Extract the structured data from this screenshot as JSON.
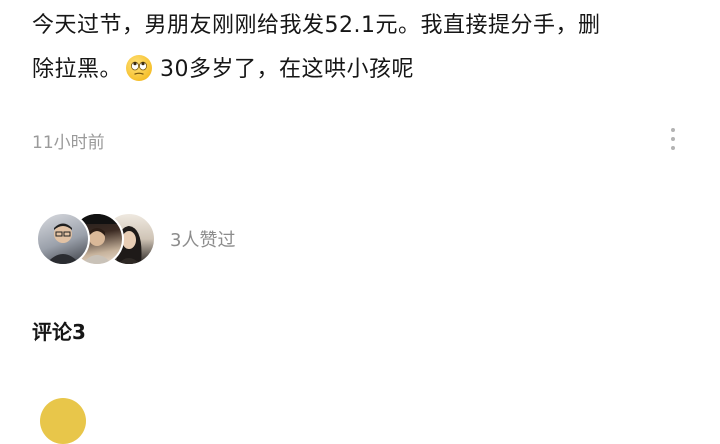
{
  "post": {
    "text_line1": "今天过节，男朋友刚刚给我发52.1元。我直接提分手，删",
    "text_line2_before": "除拉黑。",
    "emoji_icon": "eye-roll-emoji",
    "text_line2_after": "30多岁了，在这哄小孩呢"
  },
  "meta": {
    "timestamp": "11小时前",
    "more_icon": "vertical-ellipsis-icon"
  },
  "likes": {
    "text": "3人赞过",
    "avatar_count": 3
  },
  "comments": {
    "title": "评论3"
  },
  "colors": {
    "text": "#161616",
    "muted": "#9a9a9a",
    "background": "#ffffff"
  }
}
